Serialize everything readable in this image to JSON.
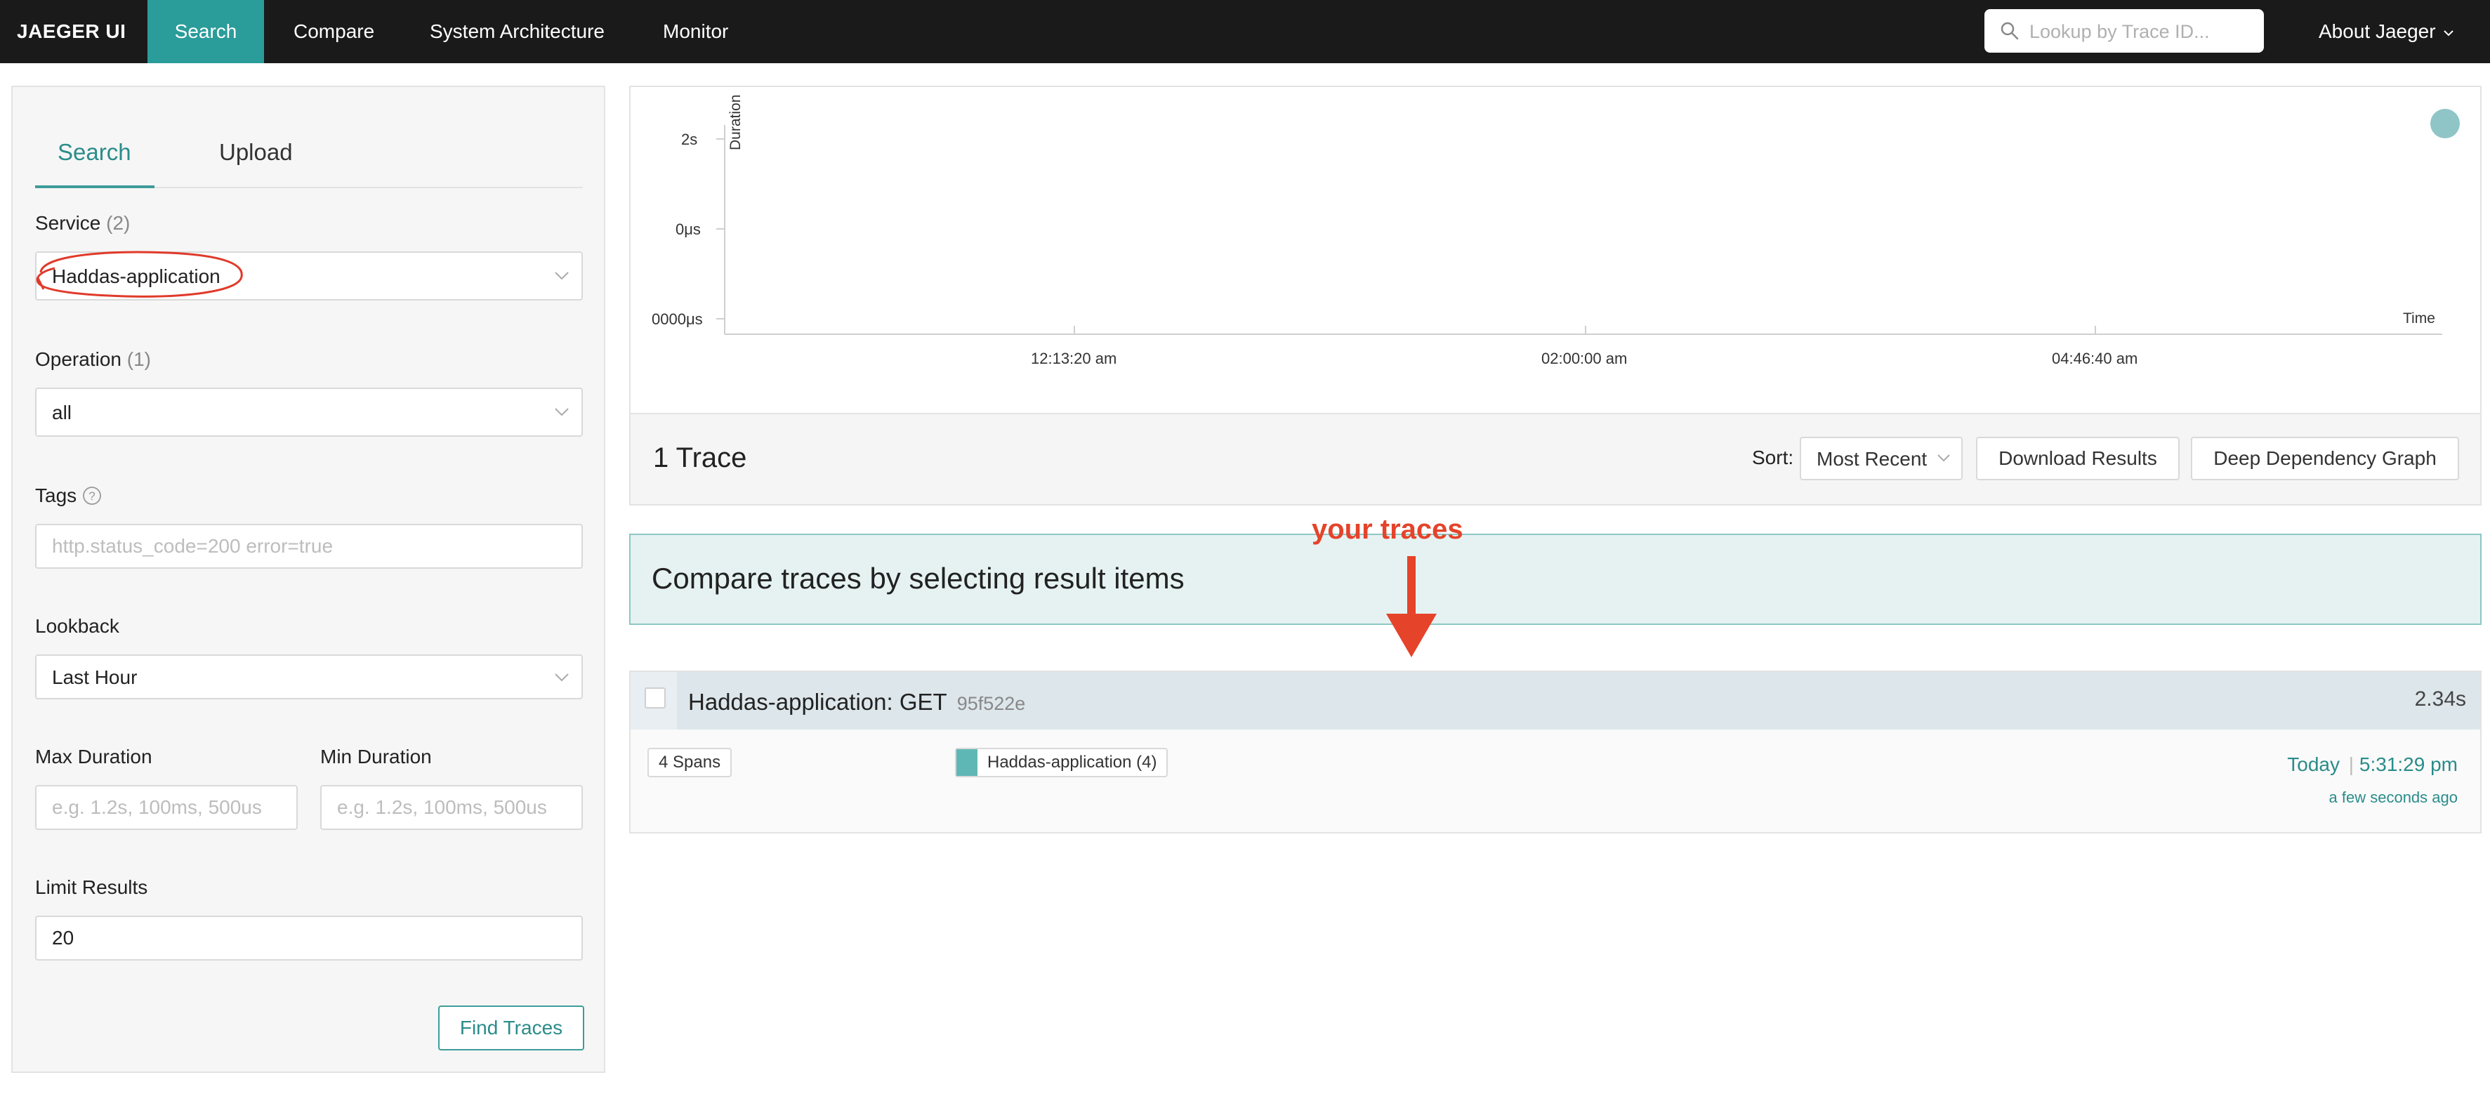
{
  "nav": {
    "brand": "JAEGER UI",
    "tabs": [
      "Search",
      "Compare",
      "System Architecture",
      "Monitor"
    ],
    "lookup_placeholder": "Lookup by Trace ID...",
    "about": "About Jaeger"
  },
  "search_panel": {
    "tabs": [
      "Search",
      "Upload"
    ],
    "service_label": "Service",
    "service_count": "(2)",
    "service_value": "Haddas-application",
    "operation_label": "Operation",
    "operation_count": "(1)",
    "operation_value": "all",
    "tags_label": "Tags",
    "tags_placeholder": "http.status_code=200 error=true",
    "lookback_label": "Lookback",
    "lookback_value": "Last Hour",
    "max_duration_label": "Max Duration",
    "max_duration_placeholder": "e.g. 1.2s, 100ms, 500us",
    "min_duration_label": "Min Duration",
    "min_duration_placeholder": "e.g. 1.2s, 100ms, 500us",
    "limit_label": "Limit Results",
    "limit_value": "20",
    "find_button": "Find Traces"
  },
  "chart_data": {
    "type": "scatter",
    "y_ticks": [
      "2s",
      "0μs",
      "0000μs"
    ],
    "x_ticks": [
      "12:13:20 am",
      "02:00:00 am",
      "04:46:40 am"
    ],
    "ylabel": "Duration",
    "xlabel": "Time",
    "point_color": "#8fc5c7"
  },
  "results": {
    "title": "1 Trace",
    "sort_label": "Sort:",
    "sort_value": "Most Recent",
    "download_button": "Download Results",
    "ddg_button": "Deep Dependency Graph",
    "compare_banner": "Compare traces by selecting result items",
    "annotation": "your traces",
    "annotation_color": "#e5432a"
  },
  "trace": {
    "name": "Haddas-application: GET",
    "id": "95f522e",
    "duration": "2.34s",
    "spans": "4 Spans",
    "service_badge": "Haddas-application (4)",
    "service_color": "#5fb7b5",
    "date": "Today",
    "time": "5:31:29 pm",
    "ago": "a few seconds ago"
  }
}
